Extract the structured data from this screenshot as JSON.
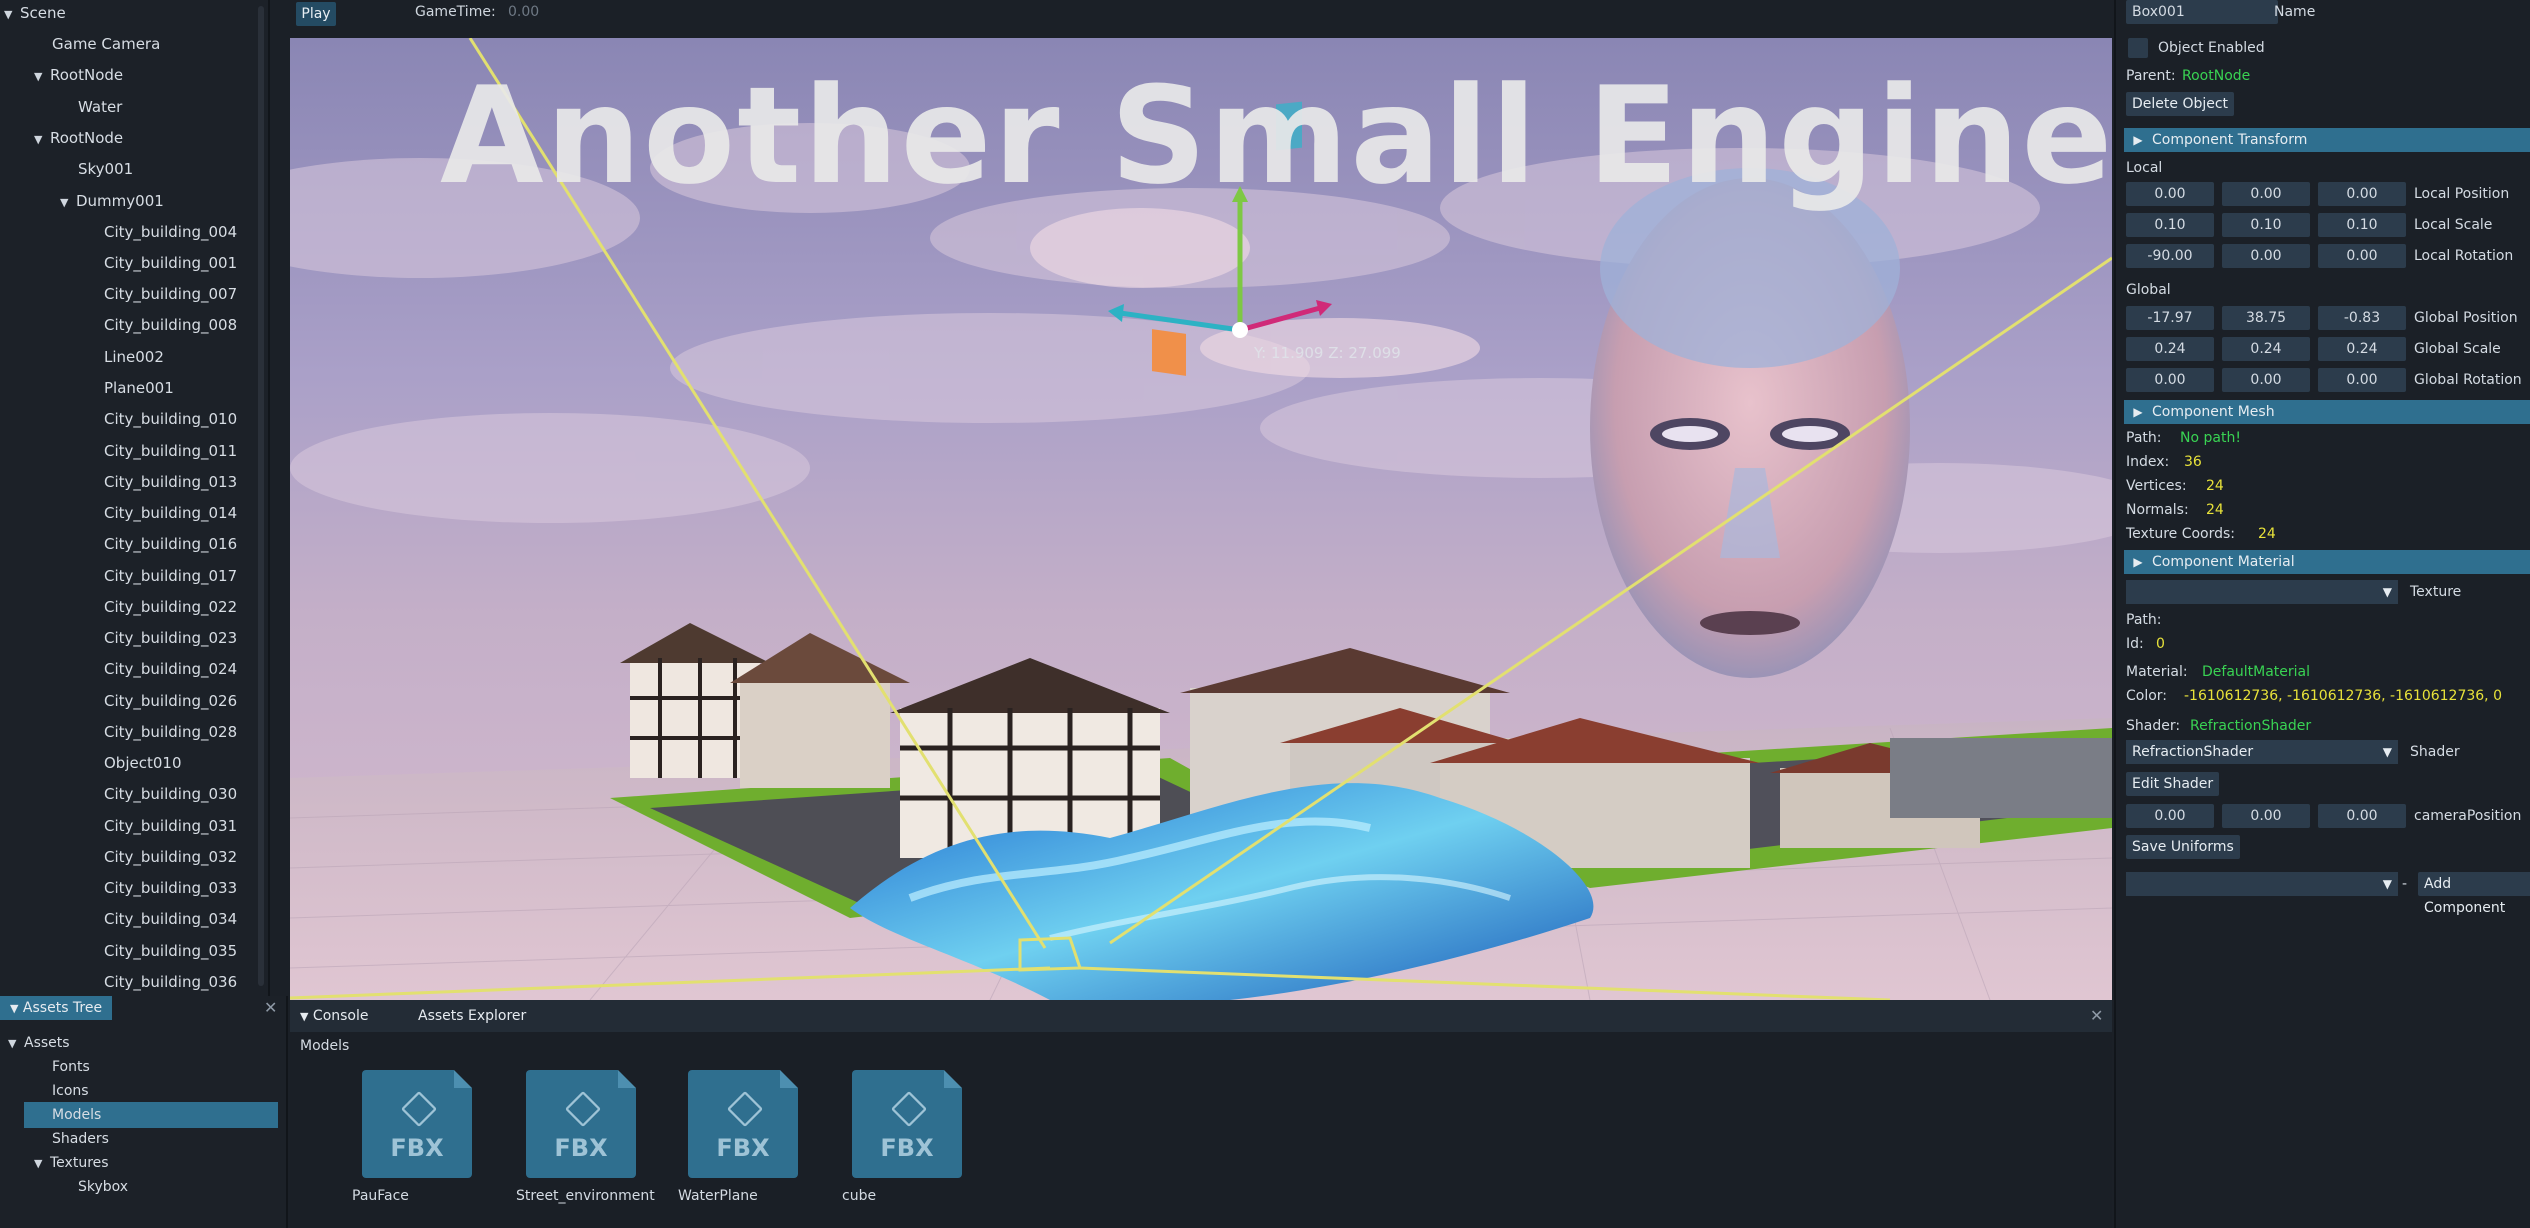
{
  "hierarchy": {
    "header": "Scene",
    "items": [
      {
        "label": "Game Camera"
      },
      {
        "label": "RootNode"
      },
      {
        "label": "Water"
      },
      {
        "label": "RootNode"
      },
      {
        "label": "Sky001"
      },
      {
        "label": "Dummy001"
      },
      {
        "label": "City_building_004"
      },
      {
        "label": "City_building_001"
      },
      {
        "label": "City_building_007"
      },
      {
        "label": "City_building_008"
      },
      {
        "label": "Line002"
      },
      {
        "label": "Plane001"
      },
      {
        "label": "City_building_010"
      },
      {
        "label": "City_building_011"
      },
      {
        "label": "City_building_013"
      },
      {
        "label": "City_building_014"
      },
      {
        "label": "City_building_016"
      },
      {
        "label": "City_building_017"
      },
      {
        "label": "City_building_022"
      },
      {
        "label": "City_building_023"
      },
      {
        "label": "City_building_024"
      },
      {
        "label": "City_building_026"
      },
      {
        "label": "City_building_028"
      },
      {
        "label": "Object010"
      },
      {
        "label": "City_building_030"
      },
      {
        "label": "City_building_031"
      },
      {
        "label": "City_building_032"
      },
      {
        "label": "City_building_033"
      },
      {
        "label": "City_building_034"
      },
      {
        "label": "City_building_035"
      },
      {
        "label": "City_building_036"
      }
    ]
  },
  "assets_tree": {
    "tab": "Assets Tree",
    "items": [
      {
        "label": "Assets"
      },
      {
        "label": "Fonts"
      },
      {
        "label": "Icons"
      },
      {
        "label": "Models"
      },
      {
        "label": "Shaders"
      },
      {
        "label": "Textures"
      },
      {
        "label": "Skybox"
      }
    ]
  },
  "toolbar": {
    "play_label": "Play",
    "gametime_label": "GameTime:",
    "gametime_value": "0.00"
  },
  "viewport": {
    "title": "Another Small Engine",
    "gizmo_readout": "Y: 11.909 Z: 27.099"
  },
  "bottom": {
    "tabs": [
      {
        "label": "Console"
      },
      {
        "label": "Assets Explorer"
      }
    ],
    "folder": "Models",
    "files": [
      {
        "name": "PauFace",
        "type": "FBX"
      },
      {
        "name": "Street_environment",
        "type": "FBX"
      },
      {
        "name": "WaterPlane",
        "type": "FBX"
      },
      {
        "name": "cube",
        "type": "FBX"
      }
    ]
  },
  "inspector": {
    "name_value": "Box001",
    "name_label": "Name",
    "enabled_label": "Object Enabled",
    "parent_label": "Parent:",
    "parent_value": "RootNode",
    "delete_label": "Delete Object",
    "transform": {
      "header": "Component Transform",
      "local_label": "Local",
      "global_label": "Global",
      "local_position": [
        "0.00",
        "0.00",
        "0.00"
      ],
      "local_position_label": "Local Position",
      "local_scale": [
        "0.10",
        "0.10",
        "0.10"
      ],
      "local_scale_label": "Local Scale",
      "local_rotation": [
        "-90.00",
        "0.00",
        "0.00"
      ],
      "local_rotation_label": "Local Rotation",
      "global_position": [
        "-17.97",
        "38.75",
        "-0.83"
      ],
      "global_position_label": "Global Position",
      "global_scale": [
        "0.24",
        "0.24",
        "0.24"
      ],
      "global_scale_label": "Global Scale",
      "global_rotation": [
        "0.00",
        "0.00",
        "0.00"
      ],
      "global_rotation_label": "Global Rotation"
    },
    "mesh": {
      "header": "Component Mesh",
      "path_label": "Path:",
      "path_value": "No path!",
      "index_label": "Index:",
      "index_value": "36",
      "vertices_label": "Vertices:",
      "vertices_value": "24",
      "normals_label": "Normals:",
      "normals_value": "24",
      "texcoords_label": "Texture Coords:",
      "texcoords_value": "24"
    },
    "material": {
      "header": "Component Material",
      "texture_label": "Texture",
      "path_label": "Path:",
      "id_label": "Id:",
      "id_value": "0",
      "material_label": "Material:",
      "material_value": "DefaultMaterial",
      "color_label": "Color:",
      "color_value": "-1610612736,  -1610612736,  -1610612736,  0",
      "shader_label": "Shader:",
      "shader_value": "RefractionShader",
      "shader_select": "RefractionShader",
      "shader_select_label": "Shader",
      "edit_shader_label": "Edit Shader",
      "camera_position": [
        "0.00",
        "0.00",
        "0.00"
      ],
      "camera_position_label": "cameraPosition",
      "save_uniforms_label": "Save Uniforms"
    },
    "add_component_sep": "-",
    "add_component_label": "Add Component"
  },
  "colors": {
    "accent": "#2f6f8f",
    "panel": "#1b2027",
    "green_text": "#39d353",
    "yellow_text": "#e8e23a"
  }
}
